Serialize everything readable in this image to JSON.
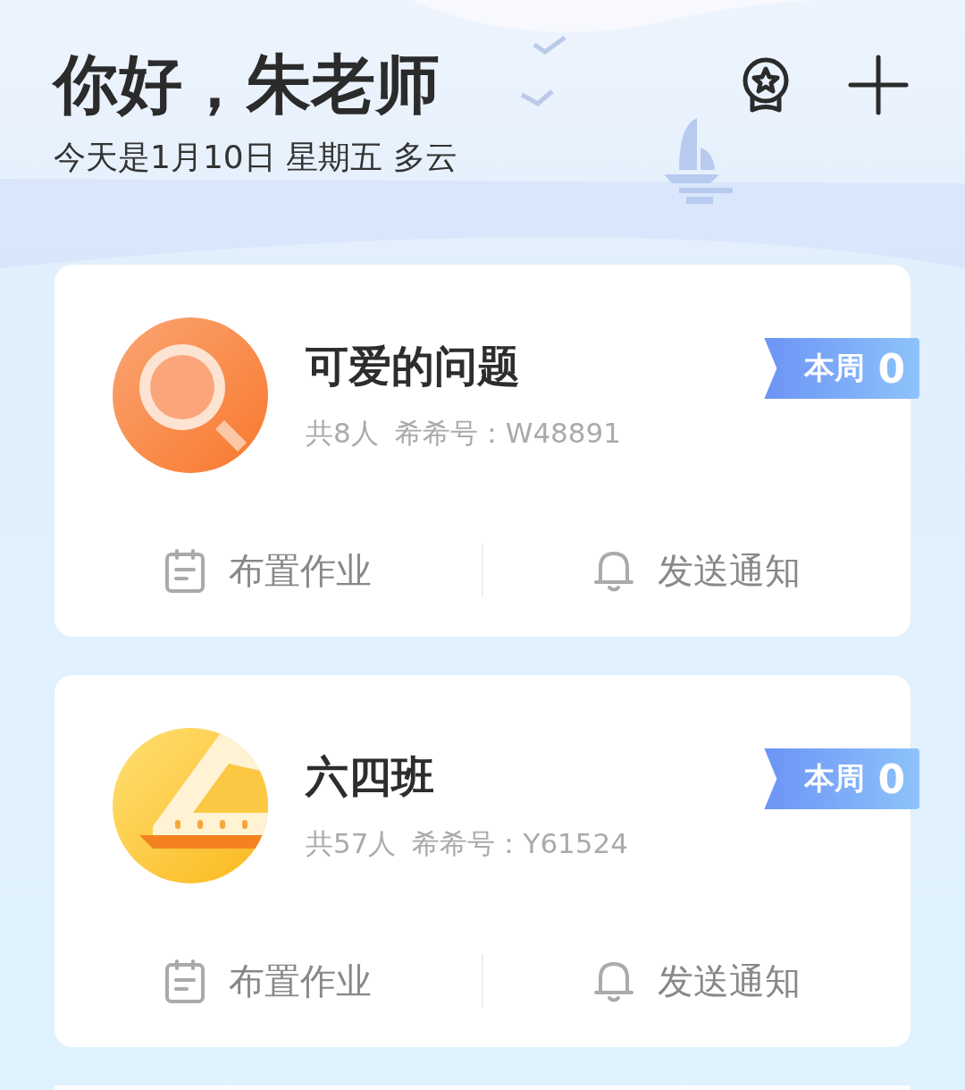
{
  "header": {
    "greeting": "你好，朱老师",
    "date_line": "今天是1月10日 星期五 多云",
    "actions": [
      {
        "kind": "medal"
      },
      {
        "kind": "add"
      }
    ]
  },
  "classes": [
    {
      "avatar": {
        "kind": "magnifier"
      },
      "name": "可爱的问题",
      "members": "共8人",
      "code": "希希号：W48891",
      "badge": {
        "label": "本周",
        "count": "0"
      },
      "actions": [
        {
          "kind": "homework",
          "label": "布置作业"
        },
        {
          "kind": "notify",
          "label": "发送通知"
        }
      ]
    },
    {
      "avatar": {
        "kind": "ruler"
      },
      "name": "六四班",
      "members": "共57人",
      "code": "希希号：Y61524",
      "badge": {
        "label": "本周",
        "count": "0"
      },
      "actions": [
        {
          "kind": "homework",
          "label": "布置作业"
        },
        {
          "kind": "notify",
          "label": "发送通知"
        }
      ]
    }
  ]
}
